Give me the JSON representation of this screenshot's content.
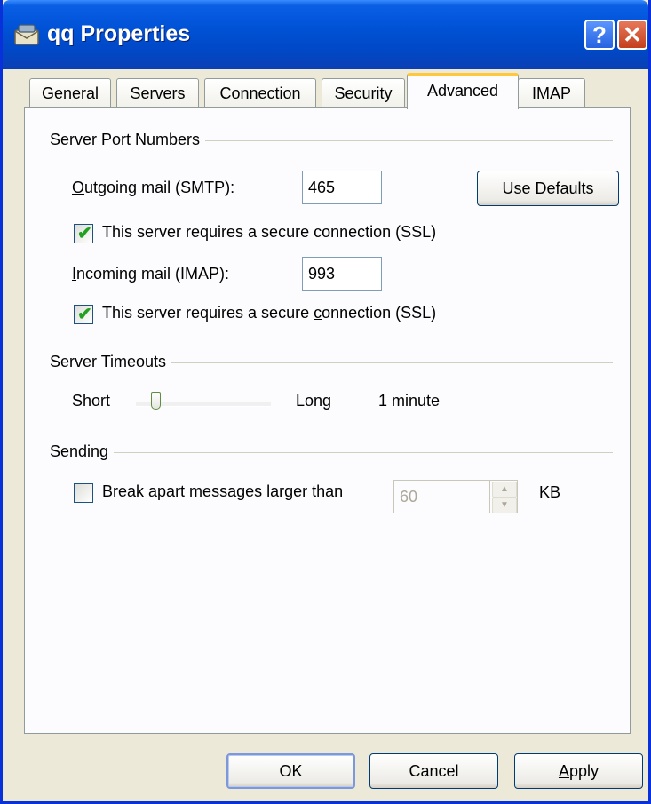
{
  "window": {
    "title": "qq Properties",
    "help_glyph": "?",
    "close_glyph": "✕"
  },
  "tabs": [
    {
      "label": "General",
      "active": false
    },
    {
      "label": "Servers",
      "active": false
    },
    {
      "label": "Connection",
      "active": false
    },
    {
      "label": "Security",
      "active": false
    },
    {
      "label": "Advanced",
      "active": true
    },
    {
      "label": "IMAP",
      "active": false
    }
  ],
  "server_ports": {
    "group_label": "Server Port Numbers",
    "outgoing": {
      "label_first": "O",
      "label_rest": "utgoing mail (SMTP):",
      "value": "465"
    },
    "use_defaults": {
      "label_first": "U",
      "label_rest": "se Defaults"
    },
    "ssl_outgoing": {
      "label": "This server requires a secure connection (SSL)",
      "checked": true
    },
    "incoming": {
      "label_first": "I",
      "label_rest": "ncoming mail (IMAP):",
      "value": "993"
    },
    "ssl_incoming": {
      "label_pre": "This server requires a secure ",
      "label_u": "c",
      "label_post": "onnection (SSL)",
      "checked": true
    }
  },
  "timeouts": {
    "group_label": "Server Timeouts",
    "short_label": "Short",
    "long_label": "Long",
    "value_text": "1 minute"
  },
  "sending": {
    "group_label": "Sending",
    "break_apart": {
      "label_first": "B",
      "label_rest": "reak apart messages larger than",
      "checked": false
    },
    "size_value": "60",
    "unit": "KB"
  },
  "footer": {
    "ok": "OK",
    "cancel": "Cancel",
    "apply_first": "A",
    "apply_rest": "pply"
  },
  "colors": {
    "titlebar": "#0052d6",
    "face": "#ece9d8",
    "active_tab_accent": "#ffc83c",
    "check": "#21a121"
  }
}
